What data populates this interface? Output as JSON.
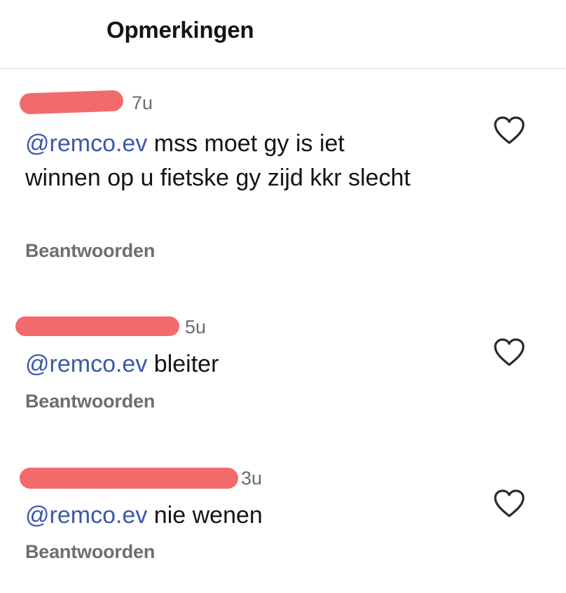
{
  "header": {
    "title": "Opmerkingen"
  },
  "comments": [
    {
      "time": "7u",
      "mention": "@remco.ev",
      "text": " mss moet gy is iet winnen op u fietske gy zijd kkr slecht",
      "reply_label": "Beantwoorden"
    },
    {
      "time": "5u",
      "mention": "@remco.ev",
      "text": " bleiter",
      "reply_label": "Beantwoorden"
    },
    {
      "time": "3u",
      "mention": "@remco.ev",
      "text": " nie wenen",
      "reply_label": "Beantwoorden"
    }
  ],
  "colors": {
    "mention": "#3b59a8",
    "redaction": "#f26a6c"
  },
  "icons": {
    "like": "heart-outline-icon"
  }
}
